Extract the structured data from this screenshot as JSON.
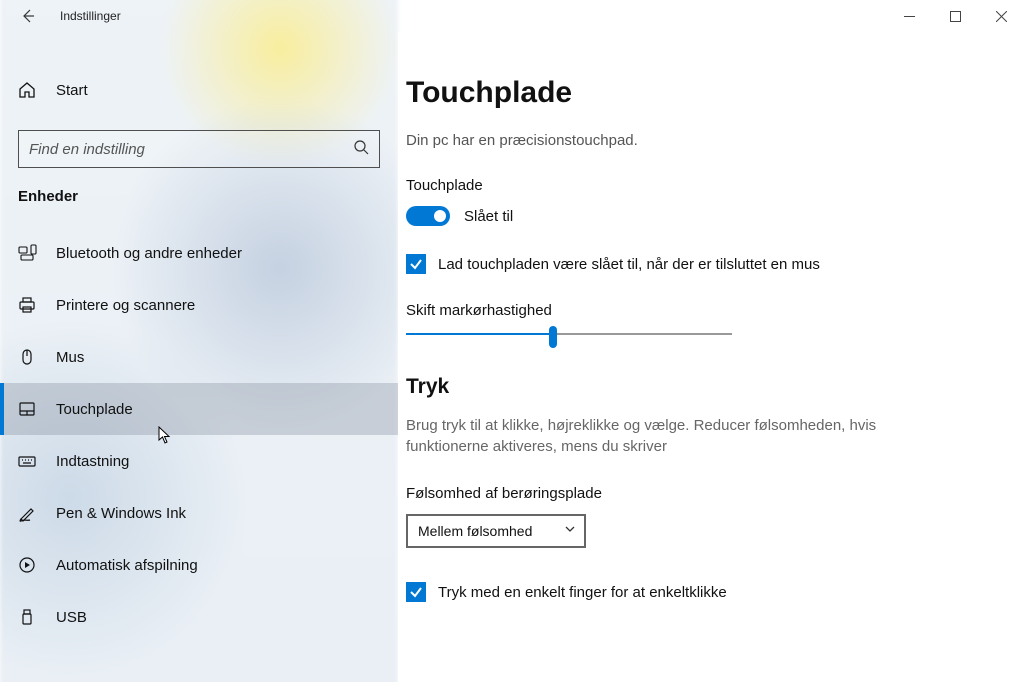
{
  "titlebar": {
    "title": "Indstillinger"
  },
  "sidebar": {
    "home": "Start",
    "search_placeholder": "Find en indstilling",
    "category": "Enheder",
    "items": [
      {
        "label": "Bluetooth og andre enheder"
      },
      {
        "label": "Printere og scannere"
      },
      {
        "label": "Mus"
      },
      {
        "label": "Touchplade"
      },
      {
        "label": "Indtastning"
      },
      {
        "label": "Pen & Windows Ink"
      },
      {
        "label": "Automatisk afspilning"
      },
      {
        "label": "USB"
      }
    ],
    "selected_index": 3
  },
  "content": {
    "title": "Touchplade",
    "subtitle": "Din pc har en præcisionstouchpad.",
    "touchpad_label": "Touchplade",
    "toggle_state": "Slået til",
    "keep_on_label": "Lad touchpladen være slået til, når der er tilsluttet en mus",
    "cursor_speed_label": "Skift markørhastighed",
    "cursor_speed_percent": 45,
    "taps_heading": "Tryk",
    "taps_body": "Brug tryk til at klikke, højreklikke og vælge. Reducer følsomheden, hvis funktionerne aktiveres, mens du skriver",
    "sensitivity_label": "Følsomhed af berøringsplade",
    "sensitivity_selected": "Mellem følsomhed",
    "single_tap_label": "Tryk med en enkelt finger for at enkeltklikke"
  }
}
